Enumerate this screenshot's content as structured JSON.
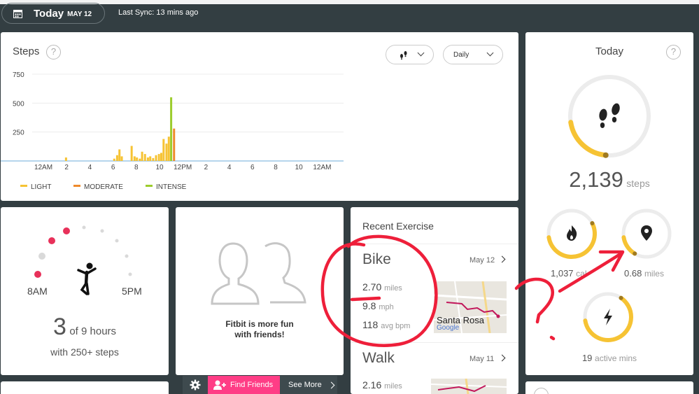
{
  "header": {
    "today": "Today",
    "date": "MAY 12",
    "last_sync": "Last Sync: 13 mins ago"
  },
  "steps_card": {
    "title": "Steps",
    "period": "Daily",
    "help": "?"
  },
  "chart_data": {
    "type": "bar",
    "title": "Steps",
    "y_ticks": [
      "750",
      "500",
      "250"
    ],
    "ylim": [
      0,
      850
    ],
    "x_tick_labels": [
      "12AM",
      "2",
      "4",
      "6",
      "8",
      "10",
      "12PM",
      "2",
      "4",
      "6",
      "8",
      "10",
      "12AM"
    ],
    "legend": [
      "LIGHT",
      "MODERATE",
      "INTENSE"
    ],
    "colors": {
      "light": "#f6c334",
      "moderate": "#ef8a2b",
      "intense": "#9ccc2c"
    },
    "bars": [
      {
        "hour": 1.95,
        "value": 30,
        "type": "light"
      },
      {
        "hour": 6.1,
        "value": 20,
        "type": "light"
      },
      {
        "hour": 6.35,
        "value": 50,
        "type": "light"
      },
      {
        "hour": 6.55,
        "value": 100,
        "type": "light"
      },
      {
        "hour": 6.75,
        "value": 40,
        "type": "light"
      },
      {
        "hour": 7.6,
        "value": 130,
        "type": "light"
      },
      {
        "hour": 7.85,
        "value": 40,
        "type": "light"
      },
      {
        "hour": 8.05,
        "value": 30,
        "type": "light"
      },
      {
        "hour": 8.3,
        "value": 20,
        "type": "light"
      },
      {
        "hour": 8.5,
        "value": 80,
        "type": "light"
      },
      {
        "hour": 8.75,
        "value": 60,
        "type": "light"
      },
      {
        "hour": 9.0,
        "value": 30,
        "type": "light"
      },
      {
        "hour": 9.2,
        "value": 40,
        "type": "light"
      },
      {
        "hour": 9.45,
        "value": 25,
        "type": "light"
      },
      {
        "hour": 9.7,
        "value": 50,
        "type": "light"
      },
      {
        "hour": 9.95,
        "value": 60,
        "type": "light"
      },
      {
        "hour": 10.15,
        "value": 70,
        "type": "light"
      },
      {
        "hour": 10.35,
        "value": 190,
        "type": "light"
      },
      {
        "hour": 10.6,
        "value": 150,
        "type": "light"
      },
      {
        "hour": 10.8,
        "value": 210,
        "type": "light"
      },
      {
        "hour": 11.0,
        "value": 550,
        "type": "intense"
      },
      {
        "hour": 11.25,
        "value": 280,
        "type": "moderate"
      }
    ]
  },
  "hourly_card": {
    "count": "3",
    "of_hours": "of 9 hours",
    "subtitle": "with 250+ steps",
    "start": "8AM",
    "end": "5PM"
  },
  "friends_card": {
    "text_line1": "Fitbit is more fun",
    "text_line2": "with friends!",
    "find_friends": "Find Friends",
    "see_more": "See More"
  },
  "exercise_card": {
    "title": "Recent Exercise",
    "items": [
      {
        "name": "Bike",
        "date": "May 12",
        "stats": [
          {
            "value": "2.70",
            "unit": "miles"
          },
          {
            "value": "9.8",
            "unit": "mph"
          },
          {
            "value": "118",
            "unit": "avg bpm"
          }
        ],
        "map_label": "Santa Rosa",
        "map_brand": "Google"
      },
      {
        "name": "Walk",
        "date": "May 11",
        "stats": [
          {
            "value": "2.16",
            "unit": "miles"
          }
        ]
      }
    ]
  },
  "today_card": {
    "title": "Today",
    "help": "?",
    "steps_value": "2,139",
    "steps_unit": "steps",
    "steps_progress": 0.21,
    "calories_value": "1,037",
    "calories_unit": "cal",
    "calories_progress": 0.55,
    "distance_value": "0.68",
    "distance_unit": "miles",
    "distance_progress": 0.14,
    "active_value": "19",
    "active_unit": "active mins",
    "active_progress": 0.63
  }
}
